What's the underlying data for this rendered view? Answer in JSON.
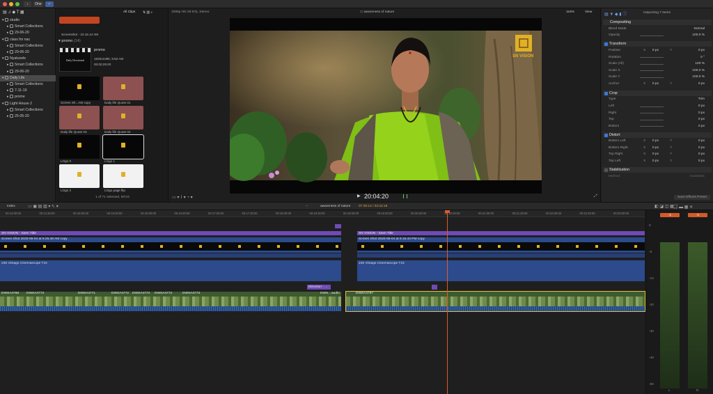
{
  "topbar": {
    "one_label": "One"
  },
  "sidebar": {
    "items": [
      {
        "label": "studio",
        "indent": 0
      },
      {
        "label": "Smart Collections",
        "indent": 1
      },
      {
        "label": "29-06-20",
        "indent": 1
      },
      {
        "label": "class for nac",
        "indent": 0
      },
      {
        "label": "Smart Collections",
        "indent": 1
      },
      {
        "label": "29-06-20",
        "indent": 1
      },
      {
        "label": "Nyatuvele",
        "indent": 0
      },
      {
        "label": "Smart Collections",
        "indent": 1
      },
      {
        "label": "29-06-20",
        "indent": 1
      },
      {
        "label": "Daily Life",
        "indent": 0
      },
      {
        "label": "Smart Collections",
        "indent": 1
      },
      {
        "label": "7-11-19",
        "indent": 1
      },
      {
        "label": "prome",
        "indent": 1
      },
      {
        "label": "Light House 2",
        "indent": 0
      },
      {
        "label": "Smart Collections",
        "indent": 1
      },
      {
        "label": "25-05-20",
        "indent": 1
      }
    ]
  },
  "browser": {
    "filter": "All Clips",
    "top_caption": "Screenshot - 10.15.14 AM",
    "event": {
      "name": "promo",
      "count": "(14)"
    },
    "promo": {
      "name": "promo",
      "meta1": "1920x1080, 9:52 AM",
      "meta2": "00:00:29:20",
      "inner": "Daily Devotional"
    },
    "clips": [
      {
        "label": "Screen Sh...AM copy",
        "style": "dark"
      },
      {
        "label": "Daily life Quote 01",
        "style": "brown"
      },
      {
        "label": "Daily life Quote 03",
        "style": "brown"
      },
      {
        "label": "Daily life Quote 02",
        "style": "brown"
      },
      {
        "label": "LOgo 0",
        "style": "dark"
      },
      {
        "label": "LOgo 1",
        "style": "dark"
      },
      {
        "label": "LOgo 2",
        "style": "white"
      },
      {
        "label": "LOgo page flip",
        "style": "white"
      }
    ],
    "status": "1 of 71 selected, 00:04"
  },
  "viewer": {
    "format": "1080p HD 29.97p, Stereo",
    "title": "awareness of nature",
    "zoom": "116%",
    "view": "View",
    "timecode": "20:04:20",
    "watermark": "SN VISION"
  },
  "inspector": {
    "title": "Inspecting 7 Items",
    "compositing": {
      "title": "Compositing",
      "blend_label": "Blend Mode",
      "blend_value": "Normal",
      "opacity_label": "Opacity",
      "opacity_value": "100.0 %"
    },
    "transform": {
      "title": "Transform",
      "rows": [
        {
          "label": "Position",
          "a": "0 px",
          "b": "0 px"
        },
        {
          "label": "Rotation",
          "a": "",
          "b": "0 °"
        },
        {
          "label": "Scale (All)",
          "a": "",
          "b": "100 %"
        },
        {
          "label": "Scale X",
          "a": "",
          "b": "100.0 %"
        },
        {
          "label": "Scale Y",
          "a": "",
          "b": "100.0 %"
        },
        {
          "label": "Anchor",
          "a": "0 px",
          "b": "0 px"
        }
      ]
    },
    "crop": {
      "title": "Crop",
      "type_label": "Type",
      "type_value": "Trim",
      "rows": [
        {
          "label": "Left",
          "value": "0 px"
        },
        {
          "label": "Right",
          "value": "0 px"
        },
        {
          "label": "Top",
          "value": "0 px"
        },
        {
          "label": "Bottom",
          "value": "0 px"
        }
      ]
    },
    "distort": {
      "title": "Distort",
      "rows": [
        {
          "label": "Bottom Left",
          "a": "0 px",
          "b": "0 px"
        },
        {
          "label": "Bottom Right",
          "a": "0 px",
          "b": "0 px"
        },
        {
          "label": "Top Right",
          "a": "0 px",
          "b": "0 px"
        },
        {
          "label": "Top Left",
          "a": "0 px",
          "b": "0 px"
        }
      ]
    },
    "stabilization": {
      "title": "Stabilization",
      "method_label": "Method",
      "method_value": "Automatic"
    },
    "save_preset": "Save Effects Preset"
  },
  "timeline": {
    "index": "Index",
    "project": "awareness of nature",
    "duration": "07:39:12 / 33:24:18",
    "ruler": [
      "00:14:00:00",
      "00:14:30:00",
      "00:15:00:00",
      "00:15:30:00",
      "00:16:00:00",
      "00:16:30:00",
      "00:17:00:00",
      "00:17:30:00",
      "00:18:00:00",
      "00:18:30:00",
      "00:19:00:00",
      "00:19:30:00",
      "00:20:00:00",
      "00:20:30:00",
      "00:21:00:00",
      "00:21:30:00",
      "00:22:00:00",
      "00:22:30:00",
      "00:23:00:00"
    ],
    "title_clip_a": "SN VISION - Seen Title",
    "title_clip_b": "SN VISION - Seen Title",
    "screen_clip_a": "Screen Shot 2020-06-04 at 9.25.48 AM copy",
    "screen_clip_b": "Screen Shot 2020-06-04 at 9.15.44 PM copy",
    "scope_a": "235 Vintage Cinemascope T23",
    "scope_b": "235 Vintage Cinemascope T23",
    "direction": "Direction - ...",
    "main_clips": [
      "DWSA4768",
      "DWSA4773",
      "DWSA4771",
      "DWSA4772",
      "DWSA4773",
      "DWSA4773",
      "DWSA4773",
      "DWS...",
      "audio"
    ],
    "second_clip": "DWSA4767"
  },
  "meters": {
    "scale": [
      "0",
      "-6",
      "-12",
      "-20",
      "-30",
      "-40",
      "-50"
    ],
    "channels": [
      "L",
      "R"
    ],
    "peaks": [
      "-1",
      "-1"
    ]
  }
}
